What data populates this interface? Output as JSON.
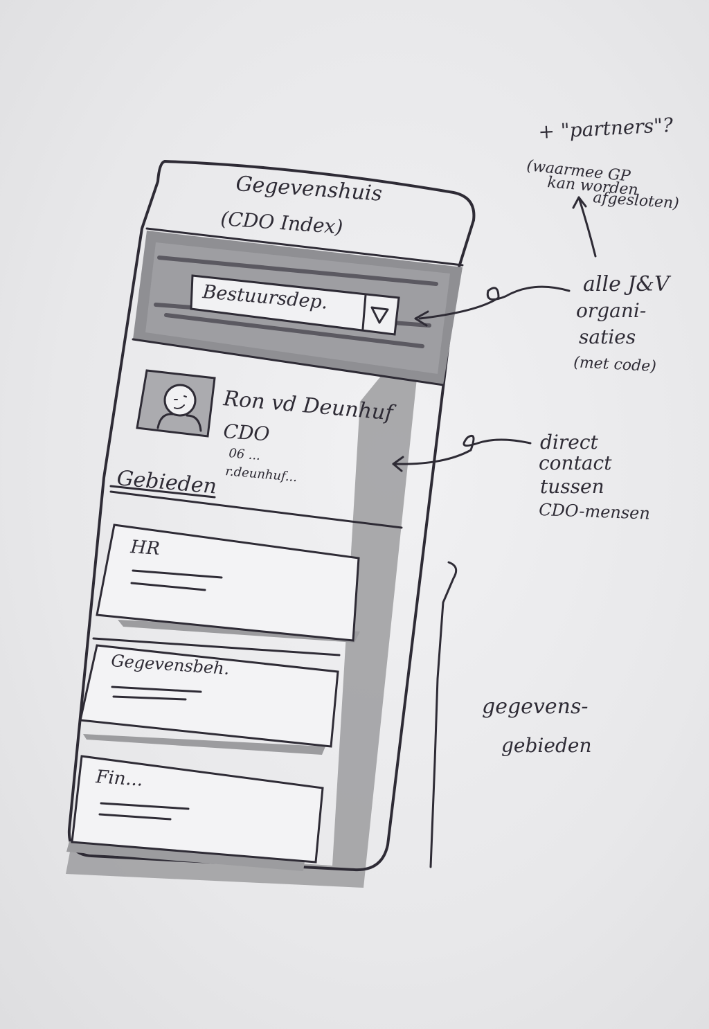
{
  "app": {
    "title": "Gegevenshuis",
    "subtitle": "(CDO Index)"
  },
  "org_select": {
    "value": "Bestuursdep.",
    "icon": "chevron-down-icon"
  },
  "contact": {
    "avatar_icon": "person-icon",
    "name": "Ron vd Deunhuf",
    "role": "CDO",
    "phone": "06 ...",
    "email": "r.deunhuf..."
  },
  "areas": {
    "heading": "Gebieden",
    "items": [
      {
        "label": "HR"
      },
      {
        "label": "Gegevensbeh."
      },
      {
        "label": "Fin..."
      }
    ]
  },
  "annotations": {
    "partners": "+ \"partners\"?",
    "partners_note_1": "(waarmee GP",
    "partners_note_2": "kan worden",
    "partners_note_3": "afgesloten)",
    "orgs_1": "alle J&V",
    "orgs_2": "organi-",
    "orgs_3": "saties",
    "orgs_4": "(met code)",
    "contact_1": "direct",
    "contact_2": "contact",
    "contact_3": "tussen",
    "contact_4": "CDO-mensen",
    "areas_1": "gegevens-",
    "areas_2": "gebieden"
  }
}
